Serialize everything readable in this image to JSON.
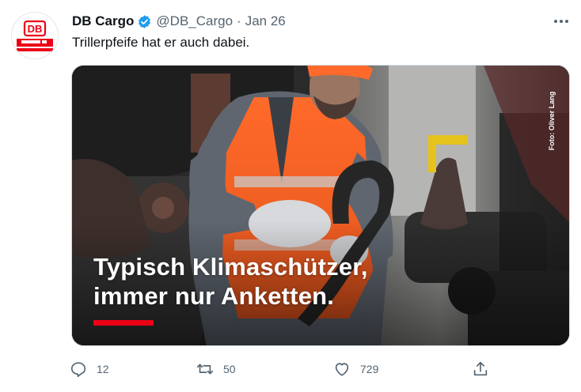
{
  "author": {
    "display_name": "DB Cargo",
    "handle": "@DB_Cargo",
    "separator": "·",
    "date": "Jan 26",
    "avatar_logo_text": "DB",
    "verified": true
  },
  "tweet": {
    "text": "Trillerpfeife hat er auch dabei."
  },
  "media": {
    "overlay_line1": "Typisch Klimaschützer,",
    "overlay_line2": "immer nur Anketten.",
    "photo_credit": "Foto: Oliver Lang",
    "accent_color": "#ec0016"
  },
  "actions": {
    "reply_count": "12",
    "retweet_count": "50",
    "like_count": "729"
  },
  "icons": [
    "more-icon",
    "verified-badge-icon",
    "reply-icon",
    "retweet-icon",
    "like-icon",
    "share-icon"
  ],
  "colors": {
    "brand_red": "#ec0016",
    "verified_blue": "#1d9bf0",
    "secondary_text": "#536471"
  }
}
